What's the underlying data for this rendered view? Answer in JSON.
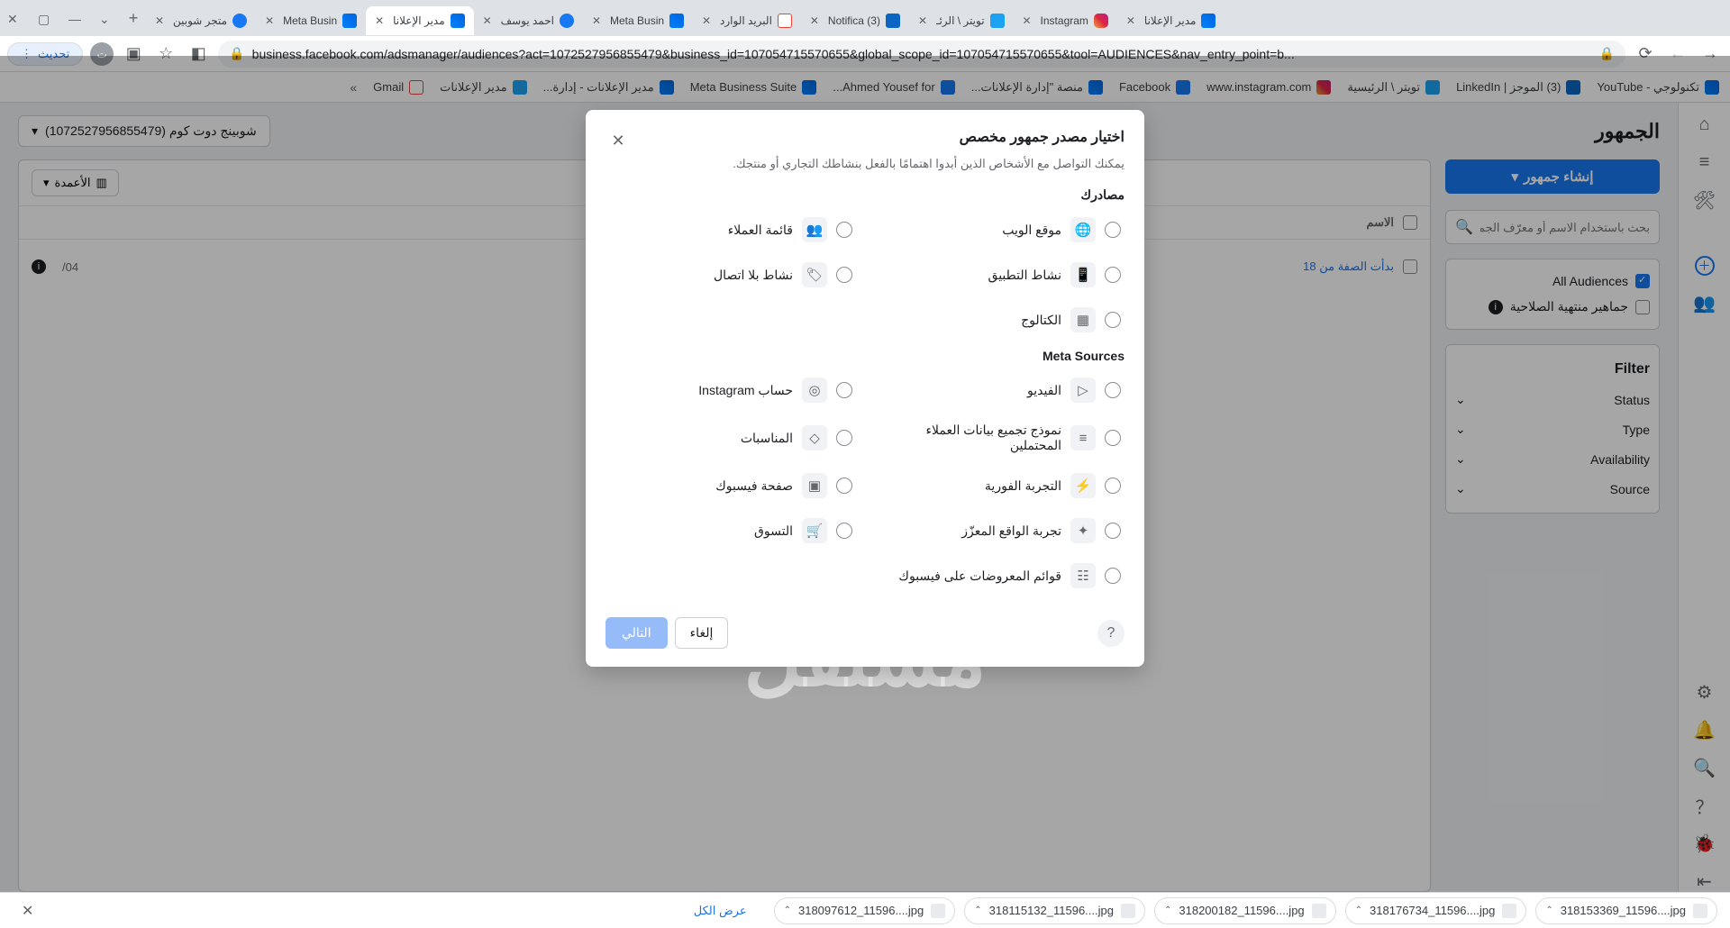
{
  "browser": {
    "update_label": "تحديث",
    "url": "business.facebook.com/adsmanager/audiences?act=1072527956855479&business_id=107054715570655&global_scope_id=107054715570655&tool=AUDIENCES&nav_entry_point=b...",
    "tabs": [
      {
        "title": "متجر شوبين",
        "fav": "fb"
      },
      {
        "title": "Meta Busin",
        "fav": "meta"
      },
      {
        "title": "مدير الإعلانا",
        "fav": "meta",
        "active": true
      },
      {
        "title": "احمد يوسف",
        "fav": "fb"
      },
      {
        "title": "Meta Busin",
        "fav": "meta"
      },
      {
        "title": "البريد الوارد",
        "fav": "gm"
      },
      {
        "title": "(3) Notifica",
        "fav": "li"
      },
      {
        "title": "تويتر \\ الرئـ",
        "fav": "tw"
      },
      {
        "title": "Instagram",
        "fav": "ig"
      },
      {
        "title": "مدير الإعلانا",
        "fav": "meta"
      }
    ],
    "bookmarks": [
      {
        "label": "Gmail",
        "fav": "gm"
      },
      {
        "label": "مدير الإعلانات",
        "fav": "tw"
      },
      {
        "label": "مدير الإعلانات - إدارة...",
        "fav": "meta"
      },
      {
        "label": "Meta Business Suite",
        "fav": "meta"
      },
      {
        "label": "Ahmed Yousef for...",
        "fav": "fb"
      },
      {
        "label": "منصة \"إدارة الإعلانات...",
        "fav": "sc"
      },
      {
        "label": "Facebook",
        "fav": "fb"
      },
      {
        "label": "www.instagram.com",
        "fav": "ig"
      },
      {
        "label": "تويتر \\ الرئيسية",
        "fav": "tw"
      },
      {
        "label": "(3) الموجز | LinkedIn",
        "fav": "li"
      },
      {
        "label": "تكنولوجي - YouTube",
        "fav": "yt"
      }
    ]
  },
  "page": {
    "title": "الجمهور",
    "account_selector": "شوبينج دوت كوم (1072527956855479)",
    "create_button": "إنشاء جمهور",
    "search_placeholder": "بحث باستخدام الاسم أو معرّف الجمهور",
    "all_audiences": "All Audiences",
    "expired_audiences": "جماهير منتهية الصلاحية",
    "filter_heading": "Filter",
    "filter_items": [
      "Status",
      "Type",
      "Availability",
      "Source"
    ],
    "columns_button": "الأعمدة",
    "table_header_name": "الاسم",
    "row1_text": "بدأت الصفة من 18",
    "row1_date": "04/"
  },
  "modal": {
    "title": "اختيار مصدر جمهور مخصص",
    "subtitle": "يمكنك التواصل مع الأشخاص الذين أبدوا اهتمامًا بالفعل بنشاطك التجاري أو منتجك.",
    "your_sources_title": "مصادرك",
    "meta_sources_title": "Meta Sources",
    "your_sources": [
      {
        "label": "موقع الويب",
        "icon": "🌐"
      },
      {
        "label": "قائمة العملاء",
        "icon": "👥"
      },
      {
        "label": "نشاط التطبيق",
        "icon": "📱"
      },
      {
        "label": "نشاط بلا اتصال",
        "icon": "🏷"
      },
      {
        "label": "الكتالوج",
        "icon": "▦"
      }
    ],
    "meta_sources": [
      {
        "label": "الفيديو",
        "icon": "▷"
      },
      {
        "label": "حساب Instagram",
        "icon": "◎"
      },
      {
        "label": "نموذج تجميع بيانات العملاء المحتملين",
        "icon": "≡"
      },
      {
        "label": "المناسبات",
        "icon": "◇"
      },
      {
        "label": "التجربة الفورية",
        "icon": "⚡"
      },
      {
        "label": "صفحة فيسبوك",
        "icon": "▣"
      },
      {
        "label": "تجربة الواقع المعزّز",
        "icon": "✦"
      },
      {
        "label": "التسوق",
        "icon": "🛒"
      },
      {
        "label": "قوائم المعروضات على فيسبوك",
        "icon": "☷"
      }
    ],
    "cancel": "إلغاء",
    "next": "التالي"
  },
  "downloads": {
    "show_all": "عرض الكل",
    "items": [
      "318097612_11596....jpg",
      "318115132_11596....jpg",
      "318200182_11596....jpg",
      "318176734_11596....jpg",
      "318153369_11596....jpg"
    ]
  },
  "watermark": "مستقل"
}
